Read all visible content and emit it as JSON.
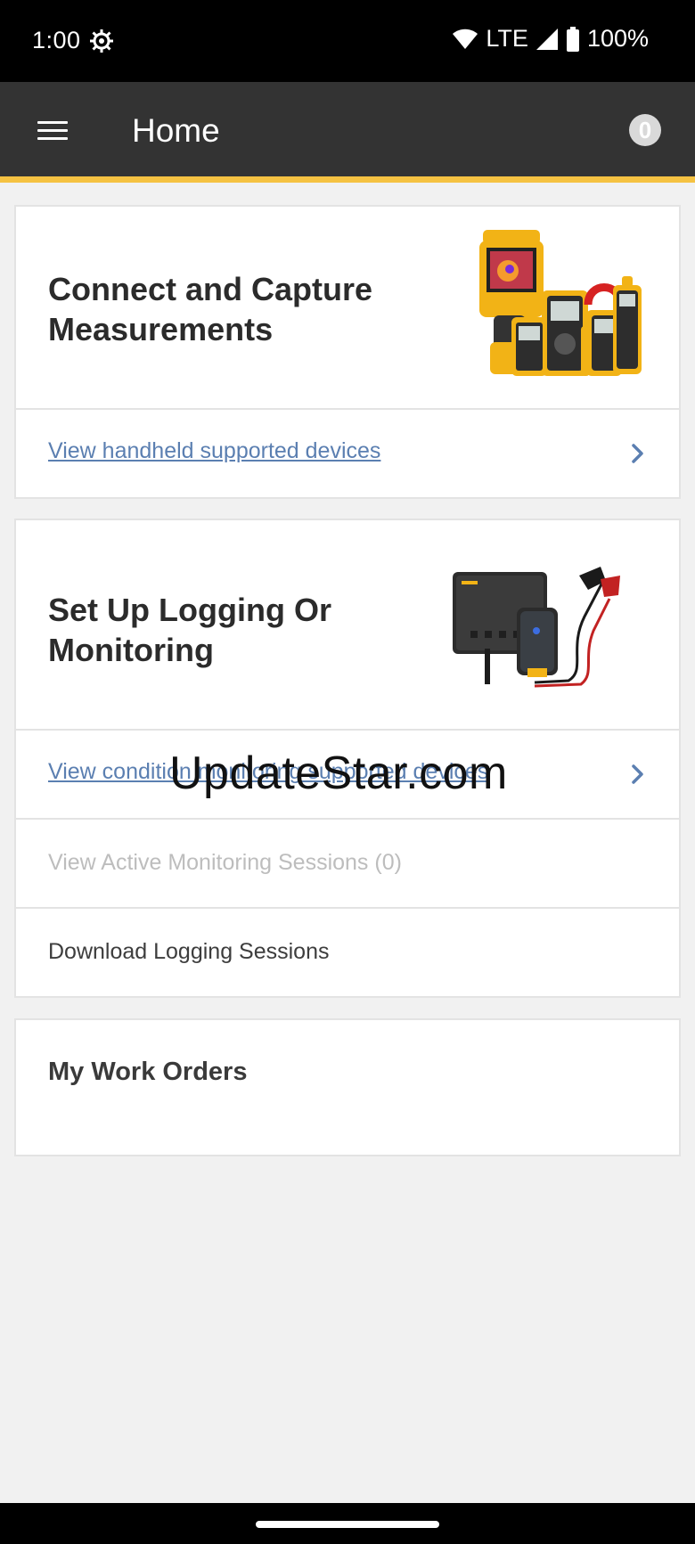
{
  "status_bar": {
    "time": "1:00",
    "network": "LTE",
    "battery": "100%"
  },
  "app_bar": {
    "title": "Home",
    "badge_count": "0",
    "accent_color": "#f5c242"
  },
  "cards": {
    "connect": {
      "title_line1": "Connect and Capture",
      "title_line2": "Measurements",
      "link": "View handheld supported devices"
    },
    "logging": {
      "title_line1": "Set Up Logging Or",
      "title_line2": "Monitoring",
      "link": "View condition monitoring supported devices",
      "active_sessions": "View Active Monitoring Sessions (0)",
      "download": "Download Logging Sessions"
    },
    "work_orders": {
      "title": "My Work Orders"
    }
  },
  "watermark": "UpdateStar.com",
  "icons": [
    "gear-icon",
    "wifi-icon",
    "signal-icon",
    "battery-icon",
    "hamburger-menu-icon",
    "chevron-right-icon"
  ]
}
